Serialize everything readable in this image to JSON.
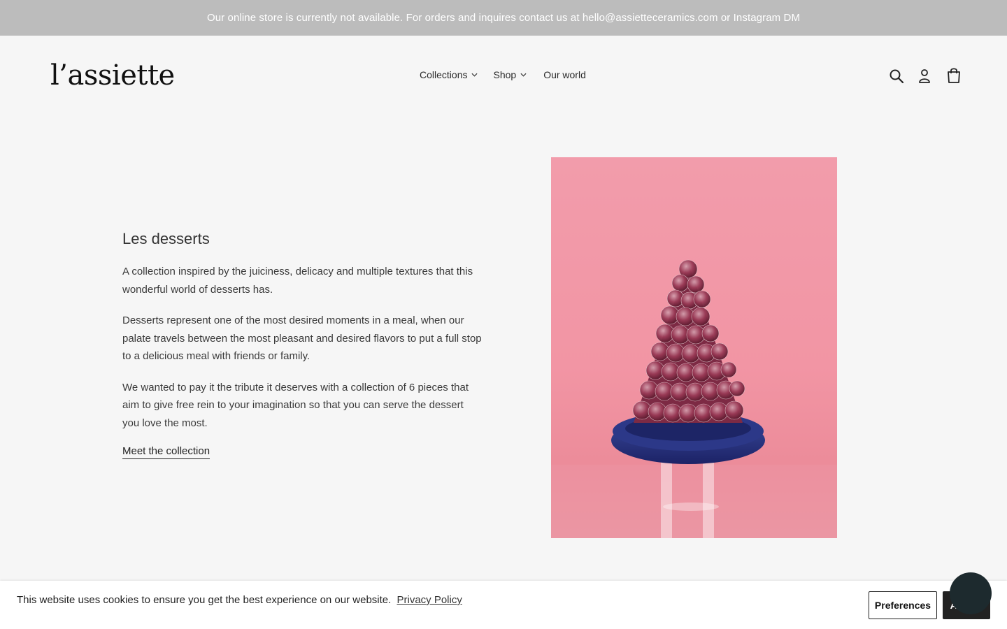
{
  "announcement": {
    "text": "Our online store is currently not available. For orders and inquires contact us at hello@assietteceramics.com or Instagram DM"
  },
  "header": {
    "logo": "l’assiette",
    "nav": [
      {
        "label": "Collections",
        "has_dropdown": true
      },
      {
        "label": "Shop",
        "has_dropdown": true
      },
      {
        "label": "Our world",
        "has_dropdown": false
      }
    ],
    "icons": [
      "search-icon",
      "account-icon",
      "cart-icon"
    ]
  },
  "hero": {
    "title": "Les desserts",
    "paragraphs": [
      "A collection inspired by the juiciness, delicacy and multiple textures that this wonderful world of desserts has.",
      "Desserts represent one of the most desired moments in a meal, when our palate travels between the most pleasant and desired flavors to put a full stop to a delicious meal with friends or family.",
      "We wanted to pay it the tribute it deserves with a collection of 6 pieces that aim to give free rein to your imagination so that you can serve the dessert you love the most."
    ],
    "link": "Meet the collection",
    "image_colors": {
      "background": "#f29cab",
      "plate": "#2a3580",
      "berries": "#8a3048"
    }
  },
  "cookie_bar": {
    "text": "This website uses cookies to ensure you get the best experience on our website.",
    "policy_link": "Privacy Policy",
    "preferences_label": "Preferences",
    "accept_label": "Accept"
  }
}
